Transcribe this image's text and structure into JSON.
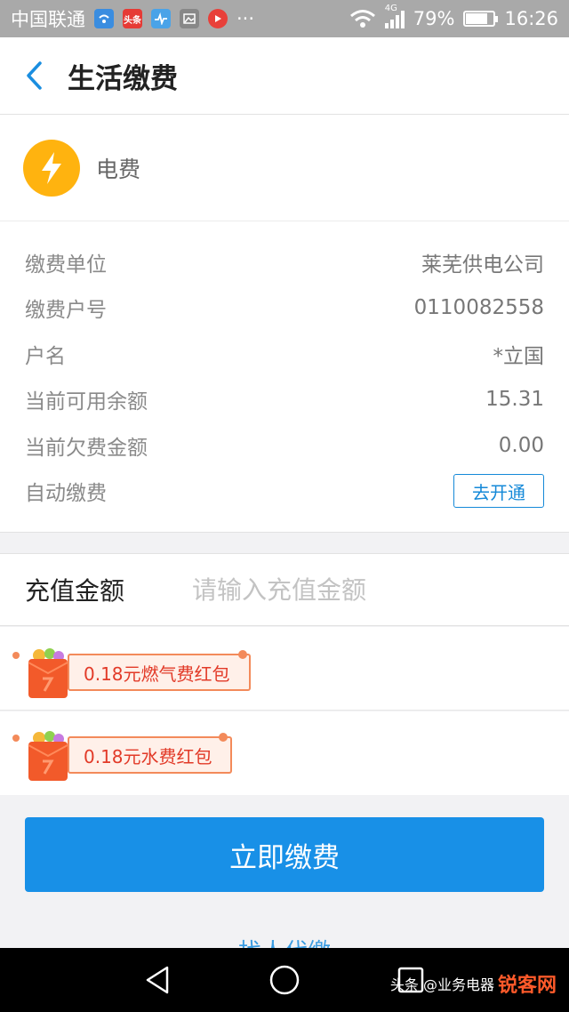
{
  "status_bar": {
    "carrier": "中国联通",
    "app_icons": [
      {
        "icon": "wifi-app-icon",
        "color": "#3a8de0"
      },
      {
        "icon": "toutiao-app-icon",
        "color": "#e63a35",
        "text": "头条"
      },
      {
        "icon": "health-app-icon",
        "color": "#4aa3e8"
      },
      {
        "icon": "gallery-app-icon",
        "color": "#888888"
      },
      {
        "icon": "video-app-icon",
        "color": "#e8403a"
      }
    ],
    "more": "···",
    "network": "4G",
    "battery_percent": "79%",
    "battery_level": 0.79,
    "time": "16:26"
  },
  "header": {
    "title": "生活缴费",
    "back_icon": "chevron-left-icon"
  },
  "utility": {
    "icon": "lightning-icon",
    "icon_color": "#ffb30f",
    "name": "电费"
  },
  "details": [
    {
      "label": "缴费单位",
      "value": "莱芜供电公司"
    },
    {
      "label": "缴费户号",
      "value": "0110082558"
    },
    {
      "label": "户名",
      "value": "*立国"
    },
    {
      "label": "当前可用余额",
      "value": "15.31"
    },
    {
      "label": "当前欠费金额",
      "value": "0.00"
    }
  ],
  "auto_pay": {
    "label": "自动缴费",
    "button": "去开通"
  },
  "amount": {
    "label": "充值金额",
    "placeholder": "请输入充值金额",
    "value": ""
  },
  "coupons": [
    {
      "text": "0.18元燃气费红包"
    },
    {
      "text": "0.18元水费红包"
    }
  ],
  "pay_button": "立即缴费",
  "partial_link": "找人代缴",
  "nav": {
    "back": "triangle-back-icon",
    "home": "circle-home-icon",
    "recent": "square-recent-icon"
  },
  "watermark": {
    "brand": "锐客网",
    "text": "头条 @业务电器"
  },
  "colors": {
    "primary": "#1890e7",
    "accent_red": "#e23a28",
    "status_bar": "#a9a9a9"
  }
}
